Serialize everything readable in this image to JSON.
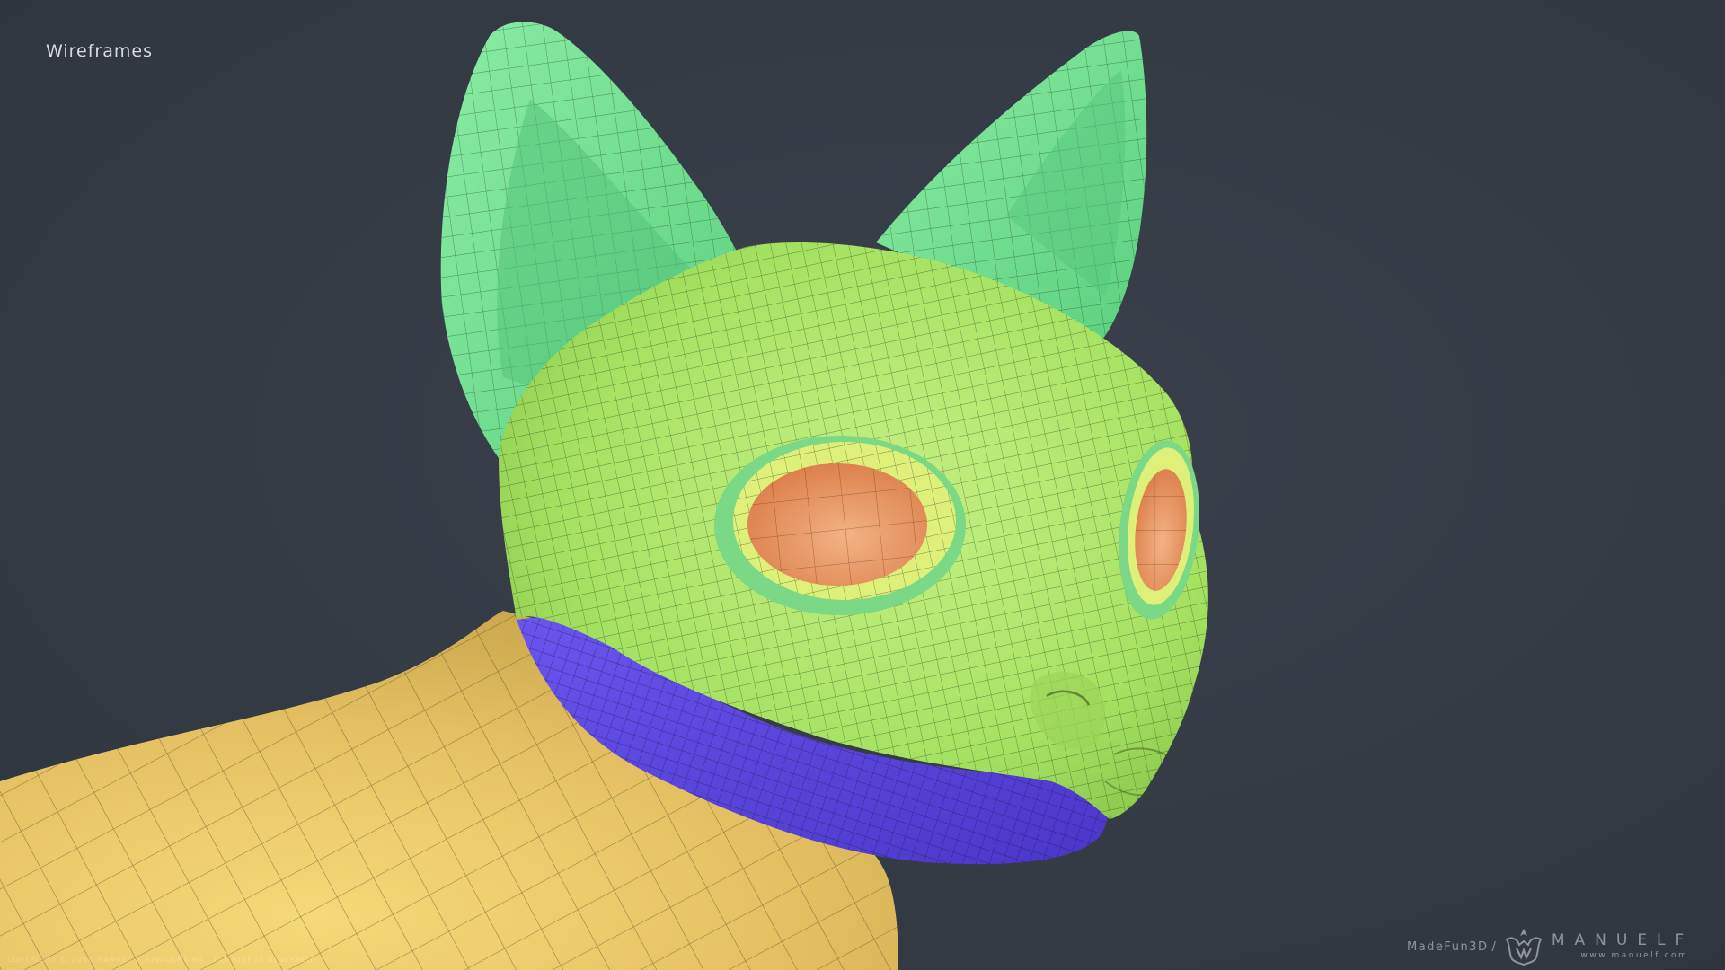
{
  "title": "Wireframes",
  "copyright": "COPYRIGHT © 2018 MANUEL F. RIVADENEIRA · ALL RIGHTS RESERVED.",
  "brand": {
    "studio": "MadeFun3D",
    "separator": "/",
    "name": "MANUELF",
    "url": "www.manuelf.com"
  },
  "colors": {
    "background": "#343b45",
    "ears": "#6fe08f",
    "head": "#a9e46a",
    "body": "#e7c66a",
    "jaw": "#5b45e0",
    "eyes": "#e9945e",
    "eye_rim": "#d9ef7a",
    "wire": "#1f2a1c"
  }
}
